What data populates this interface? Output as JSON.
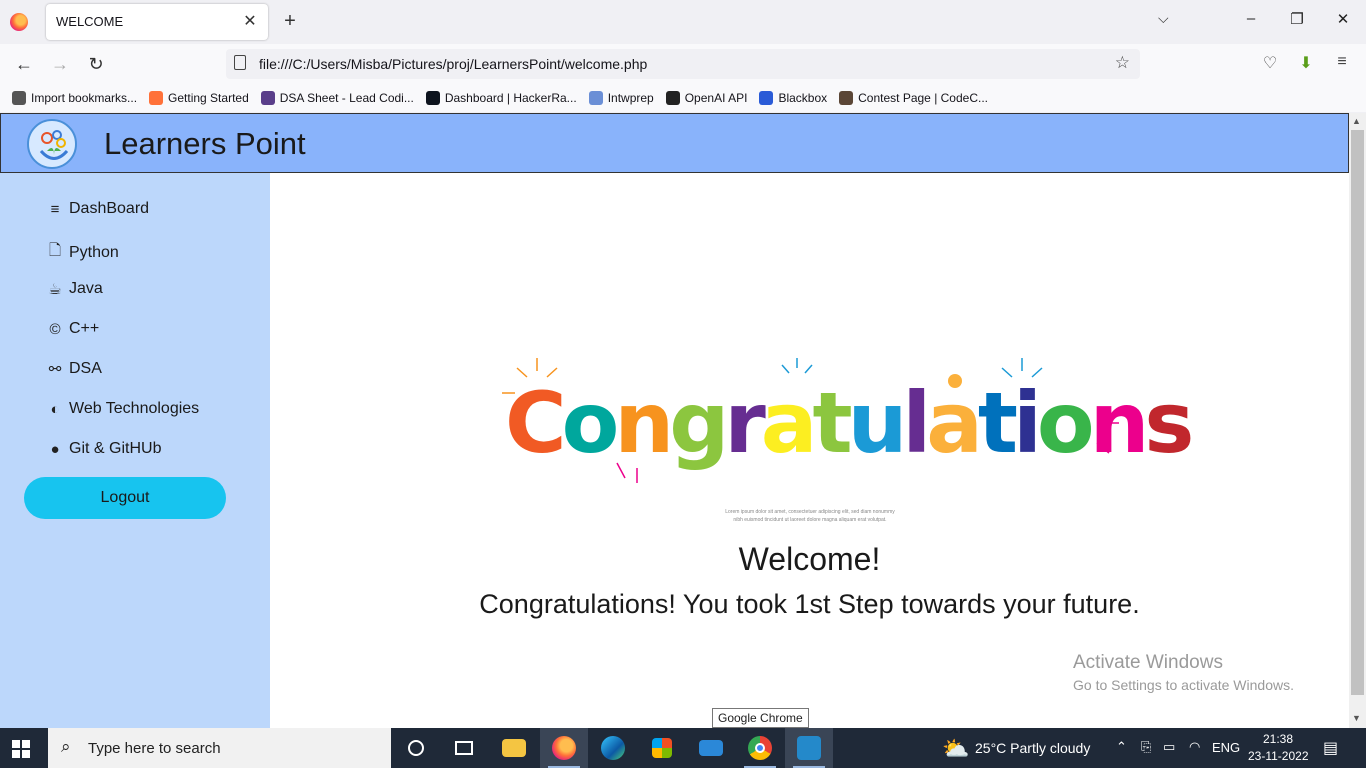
{
  "browser": {
    "tab_title": "WELCOME",
    "tab_close": "✕",
    "new_tab": "+",
    "url": "file:///C:/Users/Misba/Pictures/proj/LearnersPoint/welcome.php",
    "bookmarks": [
      {
        "label": "Import bookmarks...",
        "icon": "import-icon",
        "color": "#555555"
      },
      {
        "label": "Getting Started",
        "icon": "firefox-icon",
        "color": "#ff7139"
      },
      {
        "label": "DSA Sheet - Lead Codi...",
        "icon": "dsa-sheet-icon",
        "color": "#5a3e8a"
      },
      {
        "label": "Dashboard | HackerRa...",
        "icon": "hackerrank-icon",
        "color": "#0e141e"
      },
      {
        "label": "Intwprep",
        "icon": "intwprep-icon",
        "color": "#6b8fd6"
      },
      {
        "label": "OpenAI API",
        "icon": "openai-icon",
        "color": "#222222"
      },
      {
        "label": "Blackbox",
        "icon": "blackbox-icon",
        "color": "#2a5bd7"
      },
      {
        "label": "Contest Page | CodeC...",
        "icon": "codechef-icon",
        "color": "#5b4636"
      }
    ]
  },
  "site": {
    "brand": "Learners Point",
    "menu": [
      {
        "label": "DashBoard",
        "icon": "≡",
        "name": "dashboard"
      },
      {
        "label": "Python",
        "icon": "🗋",
        "name": "python"
      },
      {
        "label": "Java",
        "icon": "☕",
        "name": "java"
      },
      {
        "label": "C++",
        "icon": "©",
        "name": "cpp"
      },
      {
        "label": "DSA",
        "icon": "⚯",
        "name": "dsa"
      },
      {
        "label": "Web Technologies",
        "icon": "◐",
        "name": "web-technologies"
      },
      {
        "label": "Git & GitHUb",
        "icon": "●",
        "name": "git-github"
      }
    ],
    "logout": "Logout",
    "congrats_word": "Congratulations",
    "lorem_line1": "Lorem ipsum dolor sit amet, consectetuer adipiscing elit, sed diam nonummy",
    "lorem_line2": "nibh euismod tincidunt ut laoreet dolore magna aliquam erat volutpat.",
    "welcome": "Welcome!",
    "tagline": "Congratulations! You took 1st Step towards your future."
  },
  "overlay": {
    "activate_title": "Activate Windows",
    "activate_sub": "Go to Settings to activate Windows.",
    "tooltip": "Google Chrome"
  },
  "taskbar": {
    "search_placeholder": "Type here to search",
    "weather": "25°C  Partly cloudy",
    "language": "ENG",
    "time": "21:38",
    "date": "23-11-2022"
  },
  "colors": {
    "header": "#89b3fb",
    "sidebar": "#bcd7fb",
    "logout": "#17c4ef",
    "congrats_letters": [
      "#f15a24",
      "#00a79d",
      "#f7931e",
      "#8cc63f",
      "#662d91",
      "#fcee21",
      "#8cc63f",
      "#1b9ad6",
      "#662d91",
      "#fbb03b",
      "#0071bc",
      "#2e3192",
      "#39b54a",
      "#ec008c",
      "#c1272d"
    ]
  }
}
